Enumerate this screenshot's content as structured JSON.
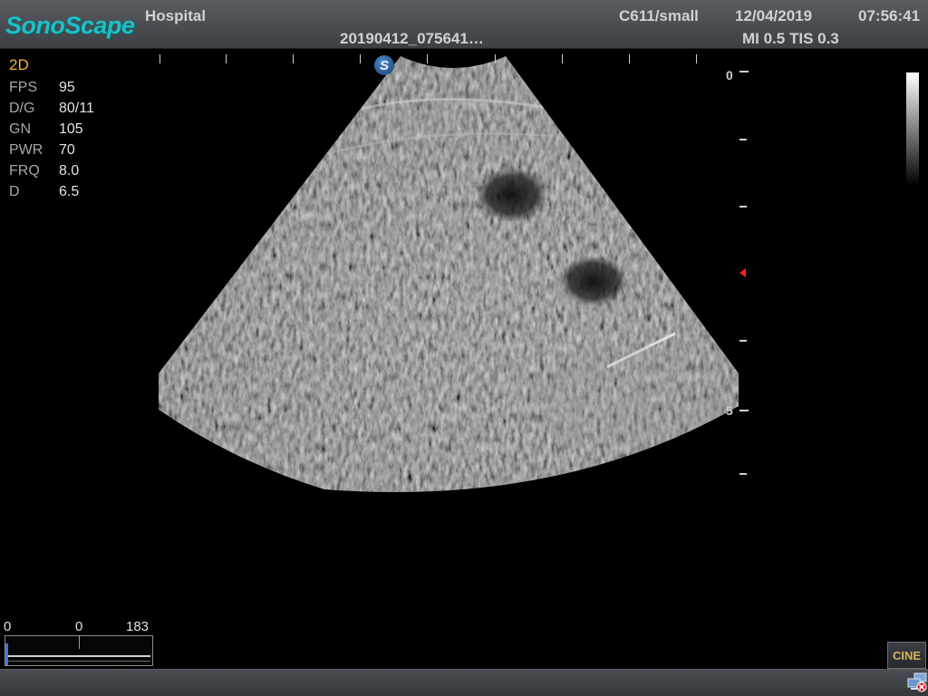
{
  "header": {
    "logo": "SonoScape",
    "hospital": "Hospital",
    "patient_id": "20190412_075641…",
    "probe_preset": "C611/small",
    "date": "12/04/2019",
    "time": "07:56:41",
    "mi_tis": "MI 0.5 TIS 0.3"
  },
  "imaging": {
    "mode": "2D",
    "params": [
      {
        "name": "FPS",
        "value": "95"
      },
      {
        "name": "D/G",
        "value": "80/11"
      },
      {
        "name": "GN",
        "value": "105"
      },
      {
        "name": "PWR",
        "value": "70"
      },
      {
        "name": "FRQ",
        "value": "8.0"
      },
      {
        "name": "D",
        "value": "6.5"
      }
    ],
    "probe_marker": "S",
    "depth_labels": {
      "top": "0",
      "mid": "5"
    }
  },
  "cine": {
    "start": "0",
    "current": "0",
    "end": "183",
    "button_label": "CINE"
  },
  "colors": {
    "accent": "#1ec0c8",
    "mode_label": "#f0b430",
    "focus_marker": "#ff2020"
  },
  "icons": {
    "network": "network-disconnected-icon",
    "focus": "focus-marker-icon"
  }
}
